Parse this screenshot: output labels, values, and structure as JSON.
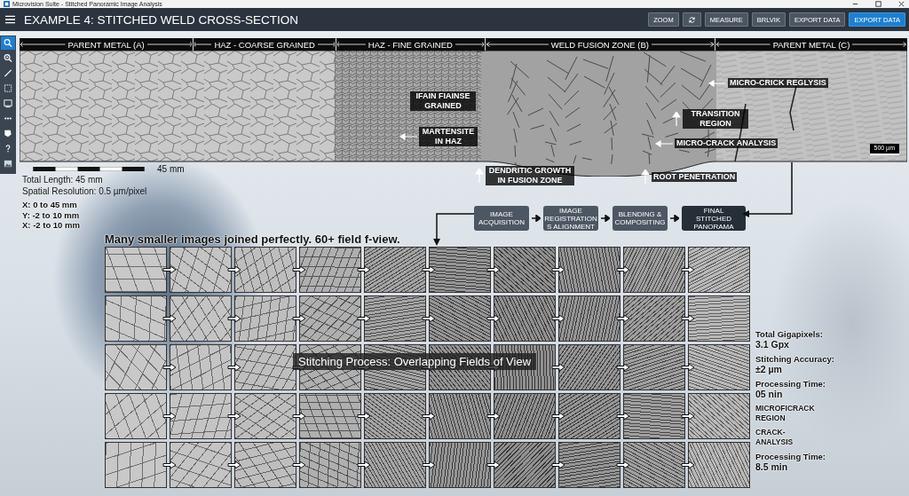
{
  "window": {
    "title": "Microvision Suite - Stitched Panoramic Image Analysis"
  },
  "toolbar": {
    "title": "EXAMPLE 4: STITCHED WELD CROSS-SECTION",
    "buttons": [
      {
        "kind": "text",
        "label": "ZOOM",
        "primary": false
      },
      {
        "kind": "refresh",
        "primary": false
      },
      {
        "kind": "text",
        "label": "MEASURE",
        "primary": false
      },
      {
        "kind": "text",
        "label": "BRLVIK",
        "primary": false
      },
      {
        "kind": "text",
        "label": "EXPORT DATA",
        "primary": false
      },
      {
        "kind": "text",
        "label": "EXPORT DATA",
        "primary": true
      }
    ]
  },
  "tools": [
    {
      "kind": "search",
      "selected": true
    },
    {
      "kind": "zoom",
      "selected": false
    },
    {
      "kind": "pen",
      "selected": false
    },
    {
      "kind": "select",
      "selected": false
    },
    {
      "kind": "frame",
      "selected": false
    },
    {
      "kind": "measure",
      "selected": false
    },
    {
      "kind": "flag",
      "selected": false
    },
    {
      "kind": "help",
      "selected": false
    },
    {
      "kind": "image",
      "selected": false
    }
  ],
  "zones": [
    "PARENT METAL (A)",
    "HAZ - COARSE GRAINED",
    "HAZ - FINE GRAINED",
    "WELD FUSION ZONE (B)",
    "PARENT METAL (C)"
  ],
  "micrograph": {
    "annotations": [
      "MICRO-CRICK REGLYSIS",
      "IFAIN FIAINSE GRAINED",
      "TRANSITION REGION",
      "MARTENSITE IN HAZ",
      "MICRO-CRACK ANALYSIS",
      "DENDRITIC GROWTH IN FUSION ZONE",
      "ROOT PENETRATION"
    ],
    "scale_bar": "500 µm"
  },
  "scale": {
    "label": "45 mm"
  },
  "info": [
    "Total Length: 45 mm",
    "Spatial Resolution: 0.5 µm/pixel"
  ],
  "ranges": [
    "X: 0 to 45 mm",
    "Y: -2 to 10 mm",
    "X: -2 to 10 mm"
  ],
  "pipeline": [
    {
      "label": "IMAGE ACQUISITION",
      "final": false
    },
    {
      "label": "IMAGE REGISTRATION S ALIGNMENT",
      "final": false
    },
    {
      "label": "BLENDING & COMPOSITING",
      "final": false
    },
    {
      "label": "FINAL STITCHED PANORAMA",
      "final": true
    }
  ],
  "caption": "Many smaller images joined perfectly. 60+ field f-view.",
  "overlay_caption": "Stitching Process: Overlapping Fields of View",
  "stats": [
    {
      "kind": "metric",
      "label": "Total Gigapixels:",
      "value": "3.1 Gpx"
    },
    {
      "kind": "metric",
      "label": "Stitching Accuracy:",
      "value": "±2 µm"
    },
    {
      "kind": "metric",
      "label": "Processing Time:",
      "value": "05 nin"
    },
    {
      "kind": "callout",
      "label": "MICROFICRACK REGION"
    },
    {
      "kind": "callout",
      "label": "CRACK- ANALYSIS"
    },
    {
      "kind": "metric",
      "label": "Processing Time:",
      "value": "8.5 min"
    }
  ]
}
